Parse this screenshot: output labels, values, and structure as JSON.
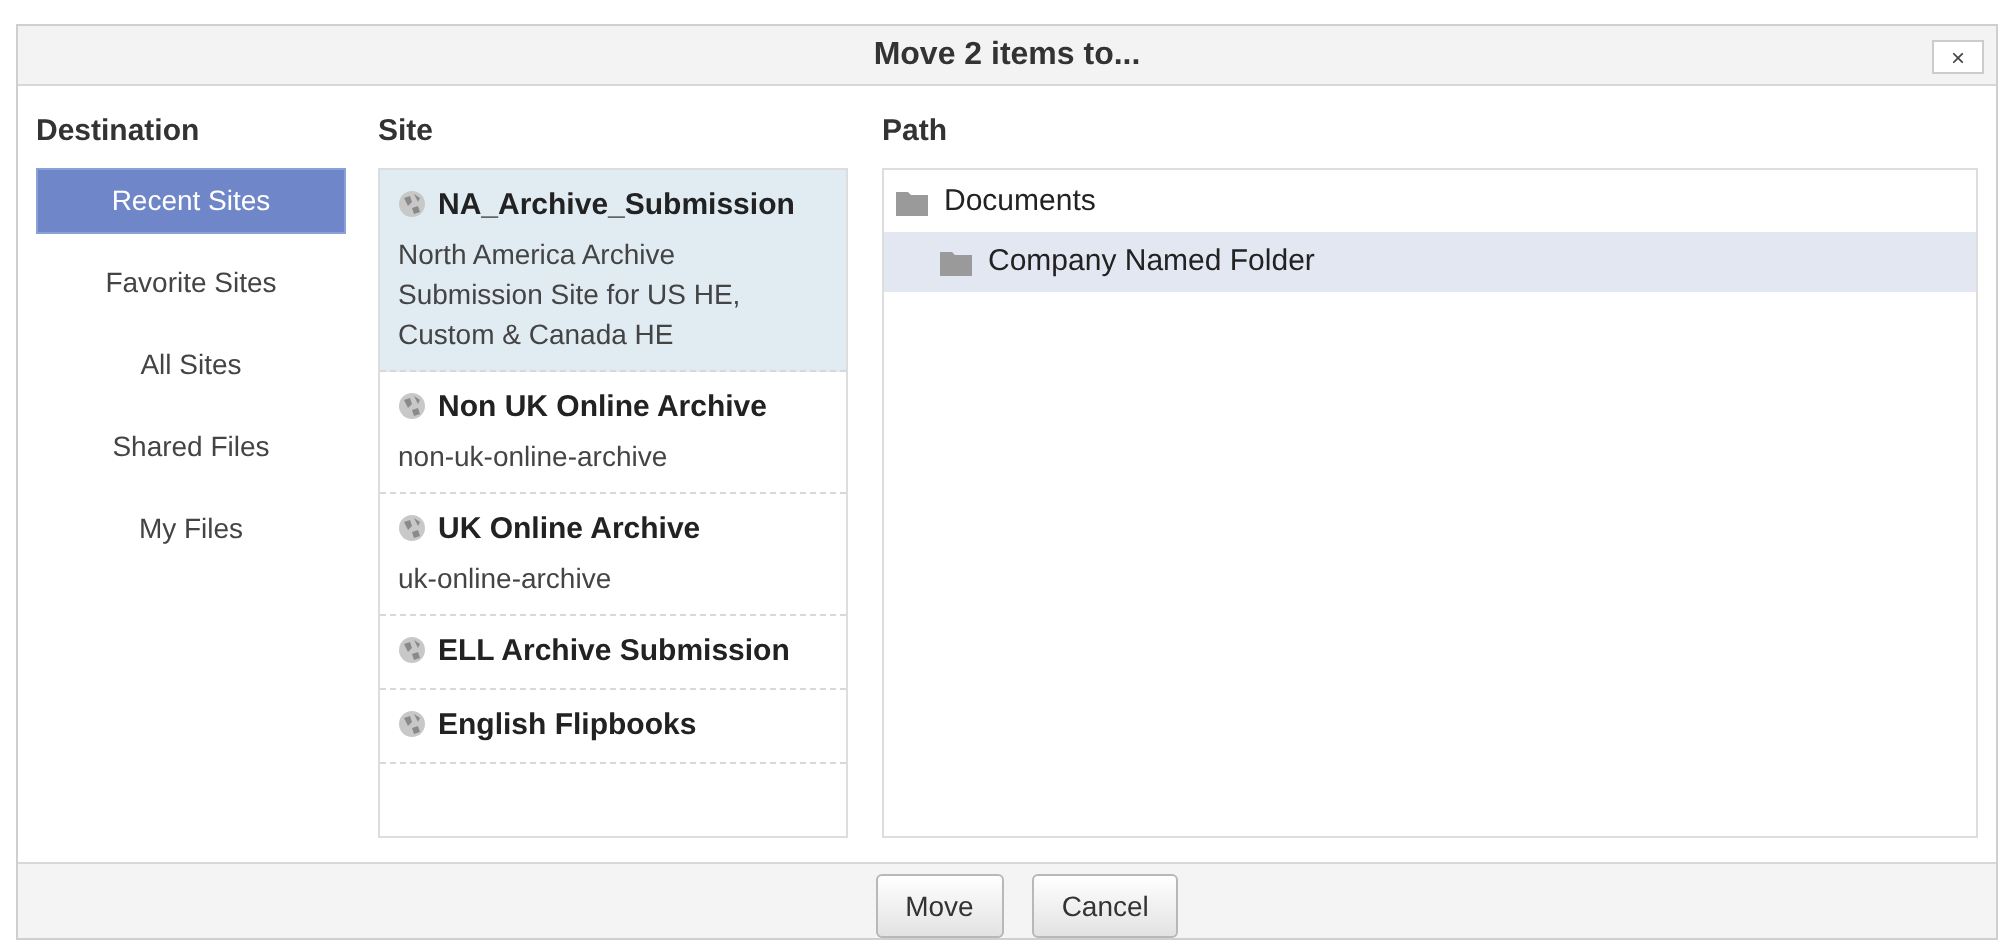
{
  "dialog": {
    "title": "Move 2 items to...",
    "close_label": "×"
  },
  "destination": {
    "heading": "Destination",
    "items": [
      {
        "label": "Recent Sites",
        "selected": true
      },
      {
        "label": "Favorite Sites",
        "selected": false
      },
      {
        "label": "All Sites",
        "selected": false
      },
      {
        "label": "Shared Files",
        "selected": false
      },
      {
        "label": "My Files",
        "selected": false
      }
    ]
  },
  "site": {
    "heading": "Site",
    "items": [
      {
        "name": "NA_Archive_Submission",
        "description": "North America Archive Submission Site for US HE, Custom & Canada HE",
        "selected": true
      },
      {
        "name": "Non UK Online Archive",
        "description": "non-uk-online-archive",
        "selected": false
      },
      {
        "name": "UK Online Archive",
        "description": "uk-online-archive",
        "selected": false
      },
      {
        "name": "ELL Archive Submission",
        "selected": false
      },
      {
        "name": "English Flipbooks",
        "selected": false
      }
    ]
  },
  "path": {
    "heading": "Path",
    "tree": [
      {
        "label": "Documents",
        "selected": false,
        "children": [
          {
            "label": "Company Named Folder",
            "selected": true
          }
        ]
      }
    ]
  },
  "buttons": [
    "Move",
    "Cancel"
  ]
}
